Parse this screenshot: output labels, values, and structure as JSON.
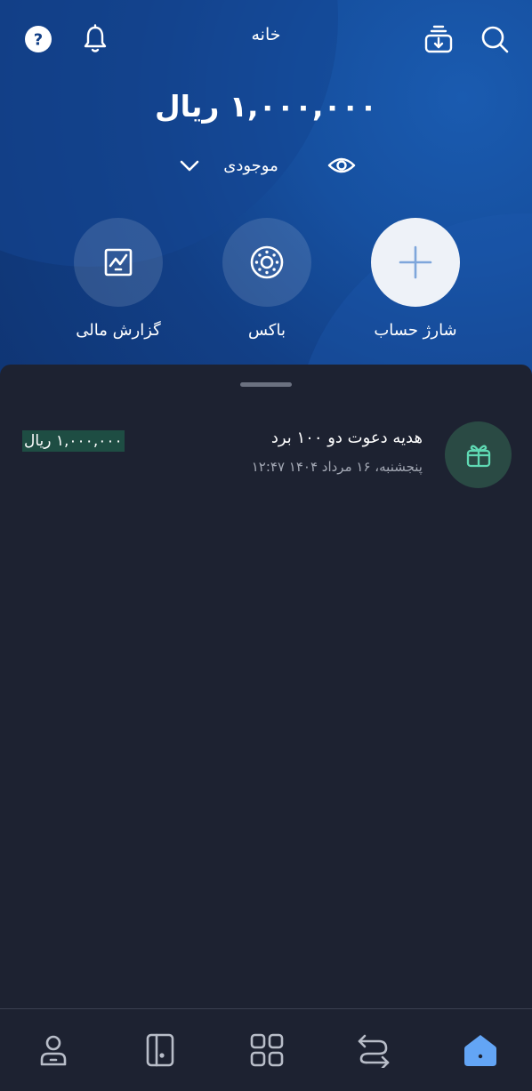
{
  "header": {
    "title": "خانه",
    "balance": "۱,۰۰۰,۰۰۰ ریال",
    "balance_label": "موجودی",
    "accent_color": "#1650a0"
  },
  "actions": [
    {
      "label": "شارژ حساب",
      "icon": "plus-icon"
    },
    {
      "label": "باکس",
      "icon": "box-icon"
    },
    {
      "label": "گزارش مالی",
      "icon": "chart-icon"
    }
  ],
  "transactions": [
    {
      "title": "هدیه دعوت دو ۱۰۰ برد",
      "date": "پنجشنبه، ۱۶ مرداد ۱۴۰۴ ۱۲:۴۷",
      "amount": "۱,۰۰۰,۰۰۰ ریال",
      "icon": "gift-icon",
      "status_color": "#5fd9b3"
    }
  ],
  "nav": [
    "home-icon",
    "transfer-icon",
    "apps-icon",
    "cards-icon",
    "profile-icon"
  ]
}
